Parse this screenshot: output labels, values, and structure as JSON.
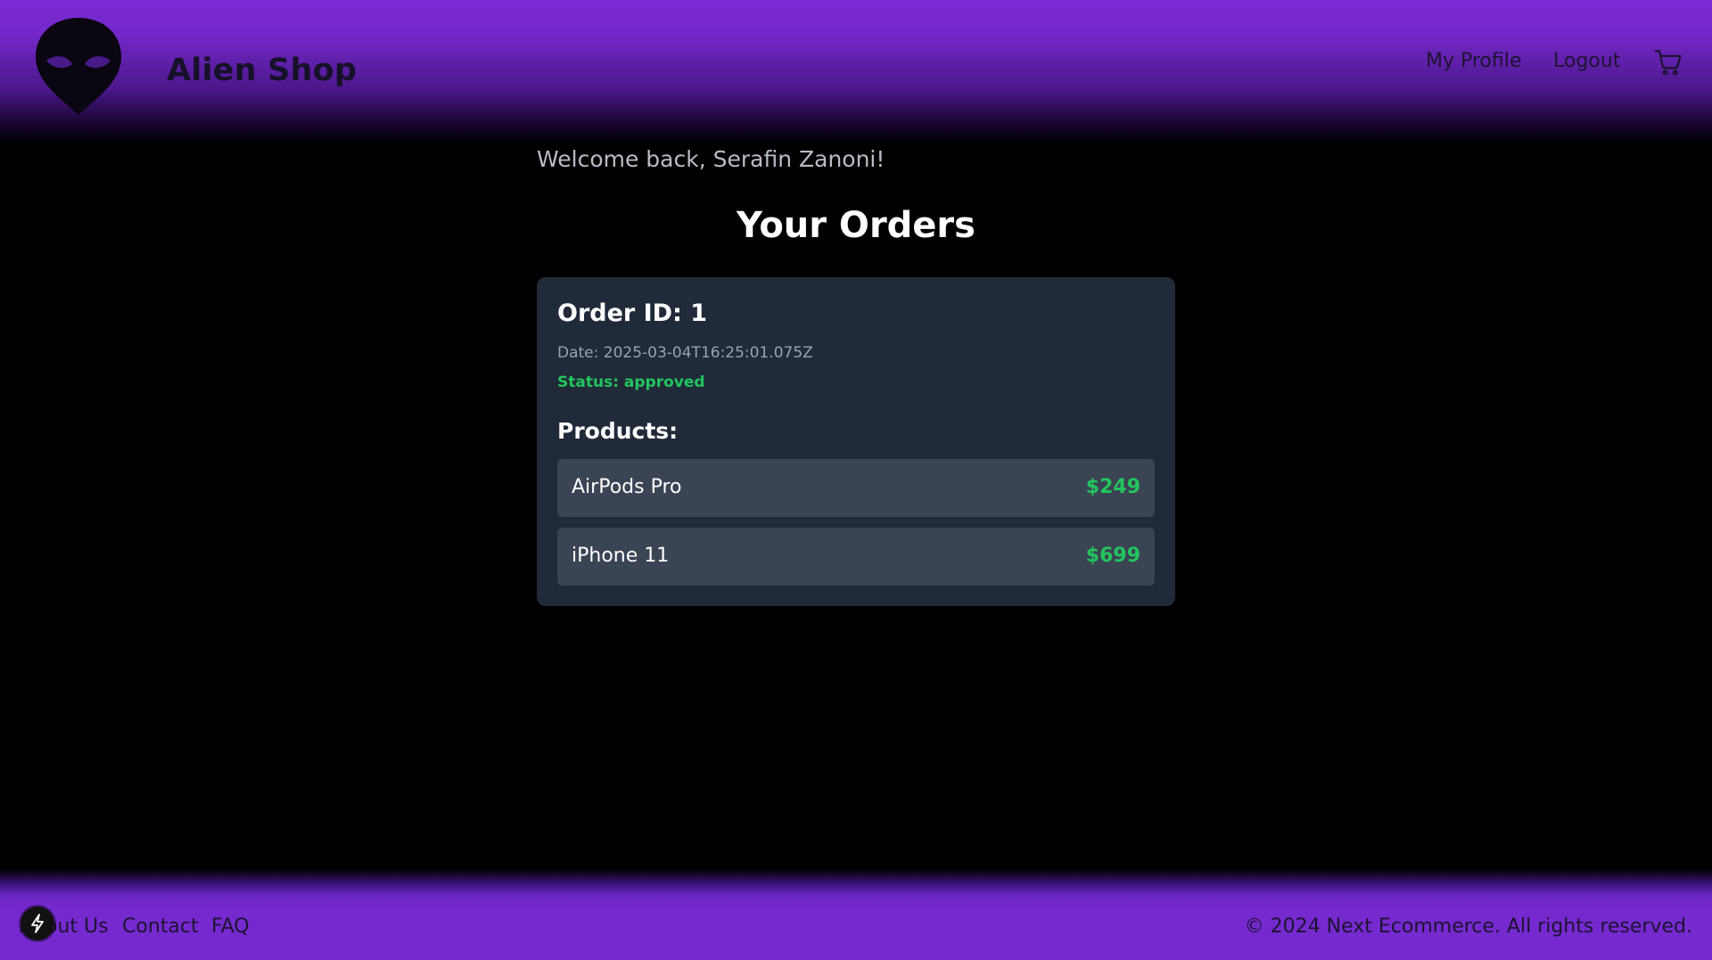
{
  "header": {
    "brand": "Alien Shop",
    "logo_icon": "alien-head-icon",
    "nav": {
      "profile_label": "My Profile",
      "logout_label": "Logout",
      "cart_icon": "shopping-cart-icon"
    }
  },
  "main": {
    "welcome": "Welcome back, Serafin Zanoni!",
    "title": "Your Orders",
    "orders": [
      {
        "id_label": "Order ID: 1",
        "date_label": "Date: 2025-03-04T16:25:01.075Z",
        "status_label": "Status: approved",
        "products_heading": "Products:",
        "products": [
          {
            "name": "AirPods Pro",
            "price": "$249"
          },
          {
            "name": "iPhone 11",
            "price": "$699"
          }
        ]
      }
    ]
  },
  "footer": {
    "links": [
      "About Us",
      "Contact",
      "FAQ"
    ],
    "copyright": "© 2024 Next Ecommerce. All rights reserved.",
    "dev_badge_icon": "lightning-icon"
  },
  "colors": {
    "brand_purple": "#7629cf",
    "card_bg": "#212a38",
    "row_bg": "#3b4453",
    "success_green": "#22c55e",
    "background": "#000000"
  }
}
